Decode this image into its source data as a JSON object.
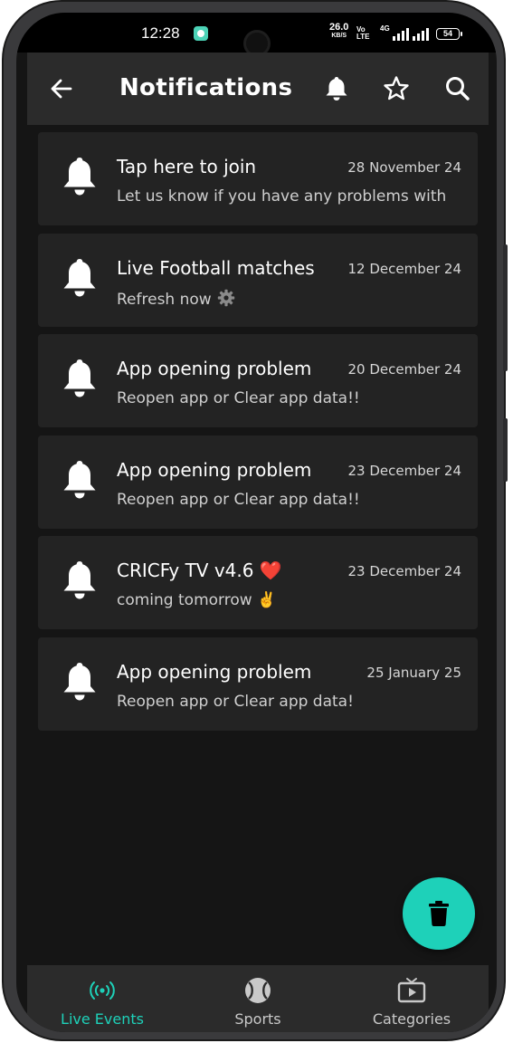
{
  "status_bar": {
    "time": "12:28",
    "net_speed": "26.0",
    "net_speed_unit": "KB/S",
    "volte": "Vo LTE",
    "network": "4G",
    "battery": "54"
  },
  "header": {
    "title": "Notifications",
    "icons": [
      "arrow-left-icon",
      "bell-icon",
      "star-icon",
      "search-icon"
    ]
  },
  "notifications": [
    {
      "title": "Tap here to join",
      "date": "28 November 24",
      "body": "Let us know if you have any problems with",
      "body_icon": ""
    },
    {
      "title": "Live Football matches",
      "date": "12 December 24",
      "body": "Refresh now",
      "body_icon": "gear-icon"
    },
    {
      "title": "App opening problem",
      "date": "20 December 24",
      "body": "Reopen app or Clear app data!!",
      "body_icon": ""
    },
    {
      "title": "App opening problem",
      "date": "23 December 24",
      "body": "Reopen app or Clear app data!!",
      "body_icon": ""
    },
    {
      "title": "CRICFy TV v4.6 ❤️",
      "date": "23 December 24",
      "body": "coming tomorrow ✌️",
      "body_icon": ""
    },
    {
      "title": "App opening problem",
      "date": "25 January 25",
      "body": "Reopen app or Clear app data!",
      "body_icon": ""
    }
  ],
  "fab": {
    "icon": "trash-icon"
  },
  "bottom_nav": [
    {
      "label": "Live Events",
      "icon": "live-signal-icon",
      "active": true
    },
    {
      "label": "Sports",
      "icon": "ball-icon",
      "active": false
    },
    {
      "label": "Categories",
      "icon": "tv-icon",
      "active": false
    }
  ],
  "colors": {
    "accent": "#1ed1b9",
    "background": "#151515",
    "card": "#232323",
    "appbar": "#2b2b2b",
    "heart": "#e53935",
    "victory_hand": "#f2b632"
  }
}
